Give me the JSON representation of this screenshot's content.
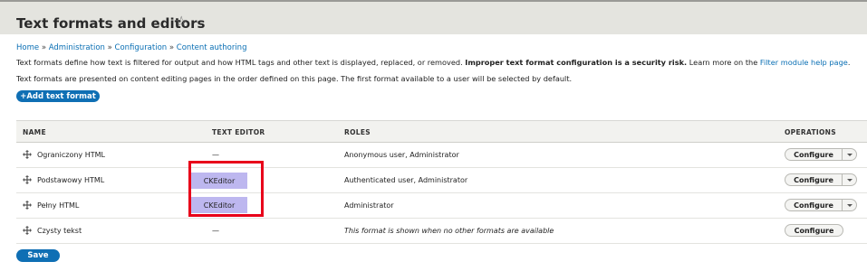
{
  "page": {
    "title": "Text formats and editors",
    "favorite_icon": "star-outline-icon"
  },
  "breadcrumb": {
    "items": [
      "Home",
      "Administration",
      "Configuration",
      "Content authoring"
    ],
    "separator": "»"
  },
  "description": {
    "line1_prefix": "Text formats define how text is filtered for output and how HTML tags and other text is displayed, replaced, or removed. ",
    "line1_bold": "Improper text format configuration is a security risk.",
    "line1_mid": " Learn more on the ",
    "line1_link": "Filter module help page",
    "line1_suffix": ".",
    "line2": "Text formats are presented on content editing pages in the order defined on this page. The first format available to a user will be selected by default."
  },
  "actions": {
    "add_label": "+Add text format",
    "save_label": "Save"
  },
  "table": {
    "headers": {
      "name": "NAME",
      "editor": "TEXT EDITOR",
      "roles": "ROLES",
      "operations": "OPERATIONS"
    },
    "rows": [
      {
        "name": "Ograniczony HTML",
        "editor": "—",
        "roles": "Anonymous user, Administrator",
        "operation": "Configure",
        "has_dropdown": true
      },
      {
        "name": "Podstawowy HTML",
        "editor": "CKEditor",
        "roles": "Authenticated user, Administrator",
        "operation": "Configure",
        "has_dropdown": true
      },
      {
        "name": "Pełny HTML",
        "editor": "CKEditor",
        "roles": "Administrator",
        "operation": "Configure",
        "has_dropdown": true
      },
      {
        "name": "Czysty tekst",
        "editor": "—",
        "roles": "This format is shown when no other formats are available",
        "operation": "Configure",
        "has_dropdown": false
      }
    ]
  },
  "colors": {
    "primary_button": "#0f6fb4",
    "link": "#0a6fb4",
    "header_band": "#e4e4df",
    "editor_highlight": "#bdb7ef",
    "annotation_box": "#e8001a"
  },
  "icons": {
    "row_handle": "drag-handle-icon",
    "dropdown": "chevron-down-icon"
  }
}
